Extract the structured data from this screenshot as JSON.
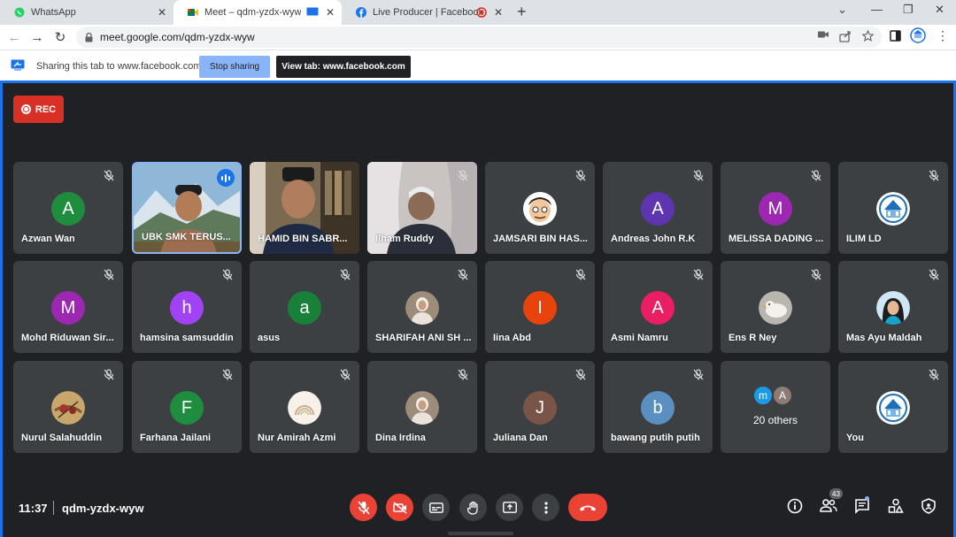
{
  "browser": {
    "tabs": [
      {
        "title": "WhatsApp",
        "icon": "whatsapp-icon",
        "active": false
      },
      {
        "title": "Meet – qdm-yzdx-wyw",
        "icon": "google-meet-icon",
        "active": true
      },
      {
        "title": "Live Producer | Facebook",
        "icon": "facebook-icon",
        "active": false
      }
    ],
    "url": "meet.google.com/qdm-yzdx-wyw"
  },
  "share_bar": {
    "message": "Sharing this tab to www.facebook.com",
    "stop_label": "Stop sharing",
    "view_label": "View tab: www.facebook.com"
  },
  "meet": {
    "rec_label": "REC",
    "time": "11:37",
    "meeting_code": "qdm-yzdx-wyw",
    "participant_count": "43",
    "participants": [
      {
        "name": "Azwan Wan",
        "initial": "A",
        "color": "#1e8e3e",
        "kind": "initial",
        "muted": true
      },
      {
        "name": "UBK SMK TERUS...",
        "initial": "",
        "color": "",
        "kind": "video-mountain",
        "muted": false,
        "speaking": true
      },
      {
        "name": "HAMID BIN SABR...",
        "initial": "",
        "color": "",
        "kind": "video-room",
        "muted": false
      },
      {
        "name": "Ilham Ruddy",
        "initial": "",
        "color": "",
        "kind": "video-curtain",
        "muted": true
      },
      {
        "name": "JAMSARI BIN HAS...",
        "initial": "",
        "color": "",
        "kind": "photo-cartoon",
        "muted": true
      },
      {
        "name": "Andreas John R.K",
        "initial": "A",
        "color": "#5e35b1",
        "kind": "initial",
        "muted": true
      },
      {
        "name": "MELISSA DADING ...",
        "initial": "M",
        "color": "#9c27b0",
        "kind": "initial",
        "muted": true
      },
      {
        "name": "ILIM LD",
        "initial": "",
        "color": "",
        "kind": "photo-logo",
        "muted": true
      },
      {
        "name": "Mohd Riduwan Sir...",
        "initial": "M",
        "color": "#9c27b0",
        "kind": "initial",
        "muted": true
      },
      {
        "name": "hamsina samsuddin",
        "initial": "h",
        "color": "#a142f4",
        "kind": "initial",
        "muted": true
      },
      {
        "name": "asus",
        "initial": "a",
        "color": "#188038",
        "kind": "initial",
        "muted": true
      },
      {
        "name": "SHARIFAH ANI SH ...",
        "initial": "",
        "color": "",
        "kind": "photo-person",
        "muted": true
      },
      {
        "name": "Iina Abd",
        "initial": "I",
        "color": "#e8430c",
        "kind": "initial",
        "muted": true
      },
      {
        "name": "Asmi Namru",
        "initial": "A",
        "color": "#e91e63",
        "kind": "initial",
        "muted": true
      },
      {
        "name": "Ens R Ney",
        "initial": "",
        "color": "",
        "kind": "photo-bird",
        "muted": true
      },
      {
        "name": "Mas Ayu Maldah",
        "initial": "",
        "color": "",
        "kind": "photo-hijab",
        "muted": true
      },
      {
        "name": "Nurul Salahuddin",
        "initial": "",
        "color": "",
        "kind": "photo-flower",
        "muted": true
      },
      {
        "name": "Farhana Jailani",
        "initial": "F",
        "color": "#1e8e3e",
        "kind": "initial",
        "muted": true
      },
      {
        "name": "Nur Amirah Azmi",
        "initial": "",
        "color": "",
        "kind": "photo-rainbow",
        "muted": true
      },
      {
        "name": "Dina Irdina",
        "initial": "",
        "color": "",
        "kind": "photo-person",
        "muted": true
      },
      {
        "name": "Juliana Dan",
        "initial": "J",
        "color": "#795548",
        "kind": "initial",
        "muted": true
      },
      {
        "name": "bawang putih putih",
        "initial": "b",
        "color": "#5a8fbf",
        "kind": "initial",
        "muted": true
      },
      {
        "name": "20 others",
        "initial": "",
        "color": "",
        "kind": "others",
        "muted": false,
        "others_initials": [
          "m",
          "A"
        ]
      },
      {
        "name": "You",
        "initial": "",
        "color": "",
        "kind": "photo-logo",
        "muted": true
      }
    ]
  }
}
